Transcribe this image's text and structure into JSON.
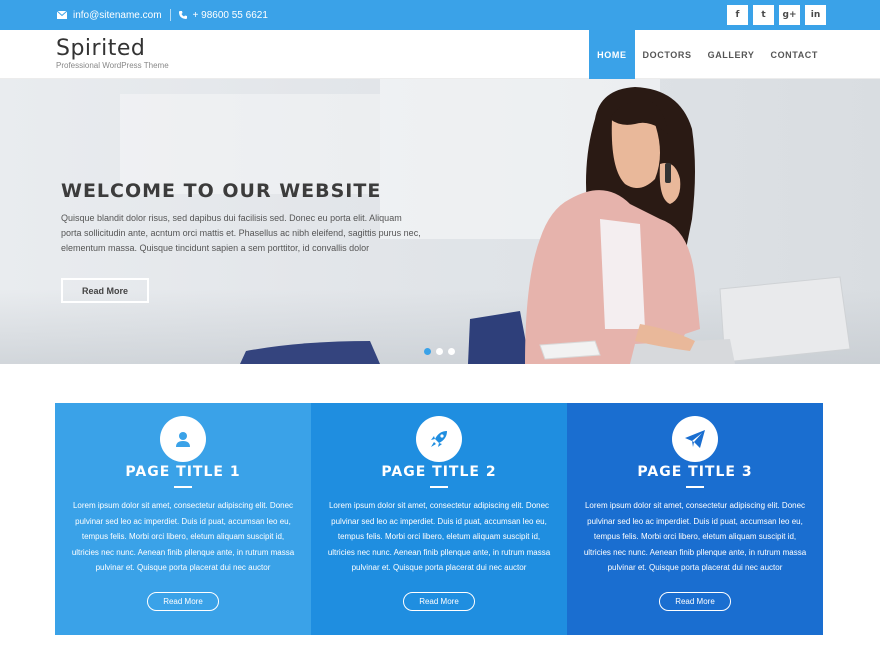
{
  "topbar": {
    "email": "info@sitename.com",
    "phone": "+ 98600 55 6621",
    "social": [
      {
        "icon": "facebook-icon",
        "glyph": "f"
      },
      {
        "icon": "twitter-icon",
        "glyph": "t"
      },
      {
        "icon": "google-plus-icon",
        "glyph": "g+"
      },
      {
        "icon": "linkedin-icon",
        "glyph": "in"
      }
    ]
  },
  "header": {
    "site_title": "Spirited",
    "tagline": "Professional WordPress Theme",
    "nav": [
      {
        "label": "HOME",
        "active": true
      },
      {
        "label": "DOCTORS",
        "active": false
      },
      {
        "label": "GALLERY",
        "active": false
      },
      {
        "label": "CONTACT",
        "active": false
      }
    ]
  },
  "hero": {
    "title": "WELCOME TO OUR WEBSITE",
    "text": "Quisque blandit dolor risus, sed dapibus dui facilisis sed. Donec eu porta elit. Aliquam porta sollicitudin ante, acntum orci mattis et. Phasellus ac nibh eleifend, sagittis purus nec, elementum massa. Quisque tincidunt sapien a sem porttitor, id convallis dolor",
    "button": "Read More",
    "slides": 3,
    "active_slide": 1
  },
  "features": [
    {
      "icon": "user-icon",
      "title": "PAGE TITLE 1",
      "text": "Lorem ipsum dolor sit amet, consectetur adipiscing elit. Donec pulvinar sed leo ac imperdiet. Duis id puat, accumsan leo eu, tempus felis. Morbi orci libero, eletum aliquam suscipit id, ultricies nec nunc. Aenean finib pllenque ante, in rutrum massa pulvinar et. Quisque porta placerat dui nec auctor",
      "button": "Read More",
      "color": "#3aa2e8"
    },
    {
      "icon": "rocket-icon",
      "title": "PAGE TITLE 2",
      "text": "Lorem ipsum dolor sit amet, consectetur adipiscing elit. Donec pulvinar sed leo ac imperdiet. Duis id puat, accumsan leo eu, tempus felis. Morbi orci libero, eletum aliquam suscipit id, ultricies nec nunc. Aenean finib pllenque ante, in rutrum massa pulvinar et. Quisque porta placerat dui nec auctor",
      "button": "Read More",
      "color": "#1f8ee0"
    },
    {
      "icon": "paper-plane-icon",
      "title": "PAGE TITLE 3",
      "text": "Lorem ipsum dolor sit amet, consectetur adipiscing elit. Donec pulvinar sed leo ac imperdiet. Duis id puat, accumsan leo eu, tempus felis. Morbi orci libero, eletum aliquam suscipit id, ultricies nec nunc. Aenean finib pllenque ante, in rutrum massa pulvinar et. Quisque porta placerat dui nec auctor",
      "button": "Read More",
      "color": "#1a6ed0"
    }
  ],
  "colors": {
    "accent": "#3aa2e8",
    "text_dark": "#3c3c3c"
  }
}
